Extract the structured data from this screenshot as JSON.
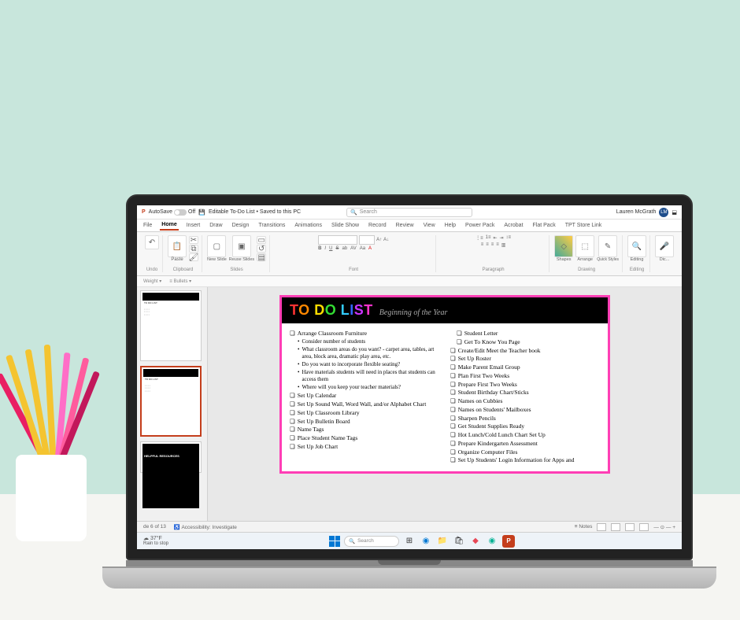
{
  "titlebar": {
    "autosave_label": "AutoSave",
    "autosave_state": "Off",
    "doc_title": "Editable To-Do List • Saved to this PC",
    "search_placeholder": "Search",
    "user_name": "Lauren McGrath",
    "user_initials": "LM"
  },
  "tabs": [
    "File",
    "Home",
    "Insert",
    "Draw",
    "Design",
    "Transitions",
    "Animations",
    "Slide Show",
    "Record",
    "Review",
    "View",
    "Help",
    "Power Pack",
    "Acrobat",
    "Flat Pack",
    "TPT Store Link"
  ],
  "active_tab": "Home",
  "ribbon": {
    "groups": [
      "Undo",
      "Clipboard",
      "Slides",
      "Font",
      "Paragraph",
      "Drawing",
      "Editing"
    ],
    "paste": "Paste",
    "new_slide": "New Slide",
    "reuse_slides": "Reuse Slides",
    "shapes": "Shapes",
    "arrange": "Arrange",
    "quick_styles": "Quick Styles",
    "editing": "Editing",
    "dictate": "Dic..."
  },
  "subribbon": {
    "weight": "Weight",
    "bullets": "Bullets"
  },
  "slide": {
    "title_chars": [
      "T",
      "O",
      " ",
      "D",
      "O",
      " ",
      "L",
      "I",
      "S",
      "T"
    ],
    "subtitle": "Beginning of the Year",
    "col1": [
      {
        "t": "Arrange Classroom Furniture",
        "chk": true
      },
      {
        "t": "Consider number of students",
        "sub": true
      },
      {
        "t": "What classroom areas do you want? - carpet area, tables, art area, block area, dramatic play area, etc.",
        "sub": true
      },
      {
        "t": "Do you want to incorporate flexible seating?",
        "sub": true
      },
      {
        "t": "Have materials students will need in places that students can access them",
        "sub": true
      },
      {
        "t": "Where will you keep your teacher materials?",
        "sub": true
      },
      {
        "t": "Set Up Calendar",
        "chk": true
      },
      {
        "t": "Set Up Sound Wall, Word Wall, and/or Alphabet Chart",
        "chk": true
      },
      {
        "t": "Set Up Classroom Library",
        "chk": true
      },
      {
        "t": "Set Up Bulletin Board",
        "chk": true
      },
      {
        "t": "Name Tags",
        "chk": true
      },
      {
        "t": "Place Student Name Tags",
        "chk": true
      },
      {
        "t": "Set Up Job Chart",
        "chk": true
      }
    ],
    "col2": [
      {
        "t": "Student Letter",
        "chk": true,
        "indent": true
      },
      {
        "t": "Get To Know You Page",
        "chk": true,
        "indent": true
      },
      {
        "t": "Create/Edit Meet the Teacher book",
        "chk": true
      },
      {
        "t": "Set Up Roster",
        "chk": true
      },
      {
        "t": "Make Parent Email Group",
        "chk": true
      },
      {
        "t": "Plan First Two Weeks",
        "chk": true
      },
      {
        "t": "Prepare First Two Weeks",
        "chk": true
      },
      {
        "t": "Student Birthday Chart/Sticks",
        "chk": true
      },
      {
        "t": "Names on Cubbies",
        "chk": true
      },
      {
        "t": "Names on Students' Mailboxes",
        "chk": true
      },
      {
        "t": "Sharpen Pencils",
        "chk": true
      },
      {
        "t": "Get Student Supplies Ready",
        "chk": true
      },
      {
        "t": "Hot Lunch/Cold Lunch Chart Set Up",
        "chk": true
      },
      {
        "t": "Prepare Kindergarten Assessment",
        "chk": true
      },
      {
        "t": "Organize Computer Files",
        "chk": true
      },
      {
        "t": "Set Up Students' Login Information for Apps and",
        "chk": true
      }
    ]
  },
  "thumbnails": {
    "t1_title": "TO DO LIST",
    "t2_title": "TO DO LIST",
    "t3_title": "HELPFUL RESOURCES"
  },
  "statusbar": {
    "slide_info": "de 6 of 13",
    "accessibility": "Accessibility: Investigate",
    "notes": "Notes"
  },
  "taskbar": {
    "temp": "37°F",
    "weather": "Rain to stop",
    "search": "Search"
  }
}
